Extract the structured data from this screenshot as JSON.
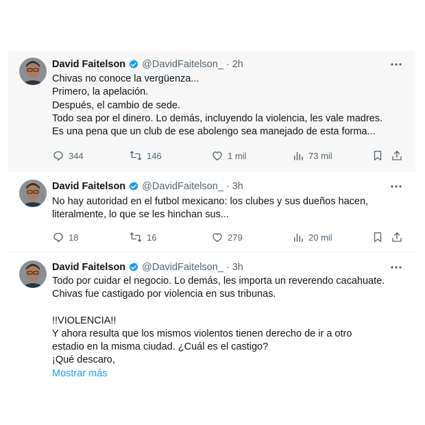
{
  "colors": {
    "accent": "#1d9bf0",
    "text": "#0f1419",
    "muted": "#536471"
  },
  "tweets": [
    {
      "author": "David Faitelson",
      "handle": "@DavidFaitelson_",
      "time": "2h",
      "lines": [
        "Chivas no conoce la vergüenza...",
        "Primero, la apelación.",
        "Después, el cambio de sede.",
        "Todo sea por el dinero. Lo demás, incluyendo la violencia, les vale madres.",
        "Es una pena que un club de ese abolengo sea manejado de esta forma..."
      ],
      "replies": "344",
      "reposts": "146",
      "likes": "1 mil",
      "views": "73 mil"
    },
    {
      "author": "David Faitelson",
      "handle": "@DavidFaitelson_",
      "time": "3h",
      "lines": [
        "No hay autoridad en el futbol mexicano: los clubes y sus dueños hacen,",
        "literalmente, lo que se les hinchan sus..."
      ],
      "replies": "18",
      "reposts": "16",
      "likes": "279",
      "views": "20 mil"
    },
    {
      "author": "David Faitelson",
      "handle": "@DavidFaitelson_",
      "time": "3h",
      "lines": [
        "Todo por cuidar el negocio. Lo demás, les importa un reverendo cacahuate.",
        "Chivas fue castigado por violencia en sus tribunas.",
        "",
        "!!VIOLENCIA!!",
        "Y ahora resulta que los mismos violentos tienen derecho de ir a otro",
        "estadio en la misma ciudad. ¿Cuál es el castigo?",
        "¡Qué descaro,"
      ],
      "show_more": "Mostrar más"
    }
  ],
  "icons": {
    "reply": "reply-icon",
    "repost": "repost-icon",
    "like": "like-icon",
    "views": "views-icon",
    "bookmark": "bookmark-icon",
    "share": "share-icon",
    "more": "more-icon",
    "verified": "verified-badge-icon"
  }
}
